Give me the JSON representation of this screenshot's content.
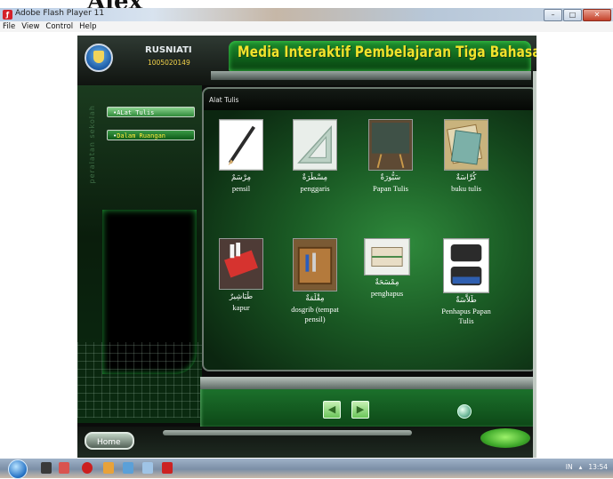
{
  "page": {
    "above_text": "Alex"
  },
  "window": {
    "title": "Adobe Flash Player 11",
    "icon": "flash-player-icon",
    "controls": [
      "minimize",
      "maximize",
      "close"
    ]
  },
  "menubar": {
    "items": [
      "File",
      "View",
      "Control",
      "Help"
    ]
  },
  "header": {
    "user_name": "RUSNIATI",
    "user_id": "1005020149",
    "app_title": "Media Interaktif Pembelajaran Tiga Bahasa"
  },
  "sidebar": {
    "vertical_label": "peralatan sekolah",
    "items": [
      {
        "label": "ALat Tulis",
        "active": true
      },
      {
        "label": "Dalam Ruangan",
        "active": false
      }
    ]
  },
  "content": {
    "panel_title": "Alat Tulis",
    "items": [
      {
        "arabic": "مِرْسَمٌ",
        "label": "pensil",
        "icon": "pencil-image"
      },
      {
        "arabic": "مِسْطَرَةٌ",
        "label": "penggaris",
        "icon": "ruler-image"
      },
      {
        "arabic": "سَبُّورَةٌ",
        "label": "Papan Tulis",
        "icon": "blackboard-image"
      },
      {
        "arabic": "كُرَّاسَةٌ",
        "label": "buku tulis",
        "icon": "notebook-image"
      },
      {
        "arabic": "طَبَاشِيرٌ",
        "label": "kapur",
        "icon": "chalk-image"
      },
      {
        "arabic": "مِقْلَمَةٌ",
        "label": "dosgrib (tempat pensil)",
        "icon": "pencil-case-image"
      },
      {
        "arabic": "مِمْسَحَةٌ",
        "label": "penghapus",
        "icon": "eraser-image"
      },
      {
        "arabic": "طَلاَّسَةٌ",
        "label": "Penhapus Papan Tulis",
        "icon": "board-eraser-image"
      }
    ]
  },
  "navigation": {
    "prev": "◀",
    "next": "▶"
  },
  "footer": {
    "home_label": "Home"
  },
  "taskbar": {
    "tray_language": "IN",
    "clock": "13:54"
  },
  "colors": {
    "title_yellow": "#f2e32c",
    "panel_green": "#1a5a24",
    "menu_text_yellow": "#ffeb3b"
  }
}
